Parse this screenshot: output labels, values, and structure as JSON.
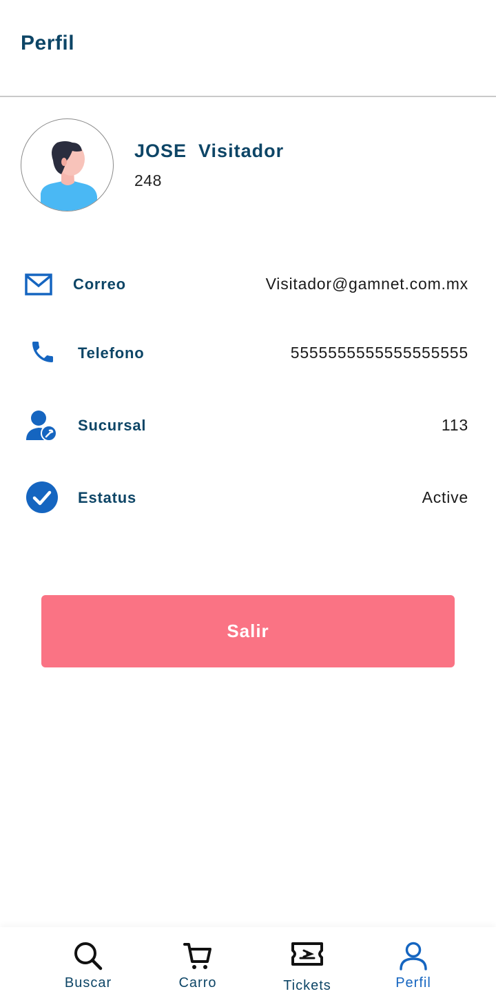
{
  "header": {
    "title": "Perfil"
  },
  "profile": {
    "name": "JOSE  Visitador",
    "id": "248"
  },
  "info": [
    {
      "icon": "envelope-icon",
      "label": "Correo",
      "value": "Visitador@gamnet.com.mx"
    },
    {
      "icon": "phone-icon",
      "label": "Telefono",
      "value": "5555555555555555555"
    },
    {
      "icon": "user-wrench-icon",
      "label": "Sucursal",
      "value": "113"
    },
    {
      "icon": "check-circle-icon",
      "label": "Estatus",
      "value": "Active"
    }
  ],
  "actions": {
    "logout_label": "Salir"
  },
  "bottom_nav": {
    "items": [
      {
        "icon": "search-icon",
        "label": "Buscar"
      },
      {
        "icon": "cart-icon",
        "label": "Carro"
      },
      {
        "icon": "ticket-icon",
        "label": "Tickets"
      },
      {
        "icon": "user-icon",
        "label": "Perfil",
        "active": true
      }
    ]
  },
  "colors": {
    "primary_text": "#0d4566",
    "accent_blue": "#1565c0",
    "logout_button": "#fa7384"
  }
}
